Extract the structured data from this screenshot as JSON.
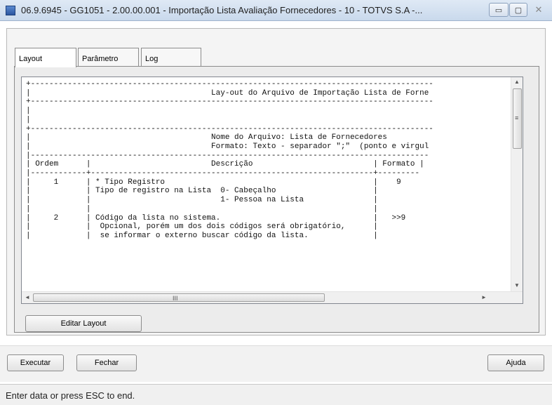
{
  "window": {
    "title": "06.9.6945 - GG1051 - 2.00.00.001 - Importação Lista Avaliação Fornecedores - 10 - TOTVS S.A -...",
    "min_label": "▭",
    "max_label": "▢",
    "close_label": "✕"
  },
  "tabs": [
    {
      "label": "Layout"
    },
    {
      "label": "Parâmetro"
    },
    {
      "label": "Log"
    }
  ],
  "layout_text": "+---------------------------------------------------------------------------------------\n|                                       Lay-out do Arquivo de Importação Lista de Forne\n+---------------------------------------------------------------------------------------\n|\n|\n+---------------------------------------------------------------------------------------\n|                                       Nome do Arquivo: Lista de Fornecedores\n|                                       Formato: Texto - separador \";\"  (ponto e virgul\n|--------------------------------------------------------------------------------------\n| Ordem      |                          Descrição                          | Formato |\n|------------+-------------------------------------------------------------+---------\n|     1      | * Tipo Registro                                             |    9\n|            | Tipo de registro na Lista  0- Cabeçalho                     |\n|            |                            1- Pessoa na Lista               |\n|            |                                                             |\n|     2      | Código da lista no sistema.                                 |   >>9\n|            |  Opcional, porém um dos dois códigos será obrigatório,      |\n|            |  se informar o externo buscar código da lista.              |",
  "scroll": {
    "up": "▲",
    "down": "▼",
    "left": "◄",
    "right": "►",
    "grip_h": "III",
    "grip_v": "≡"
  },
  "buttons": {
    "edit_layout": "Editar Layout",
    "execute": "Executar",
    "close": "Fechar",
    "help": "Ajuda"
  },
  "status": "Enter data or press ESC to end."
}
